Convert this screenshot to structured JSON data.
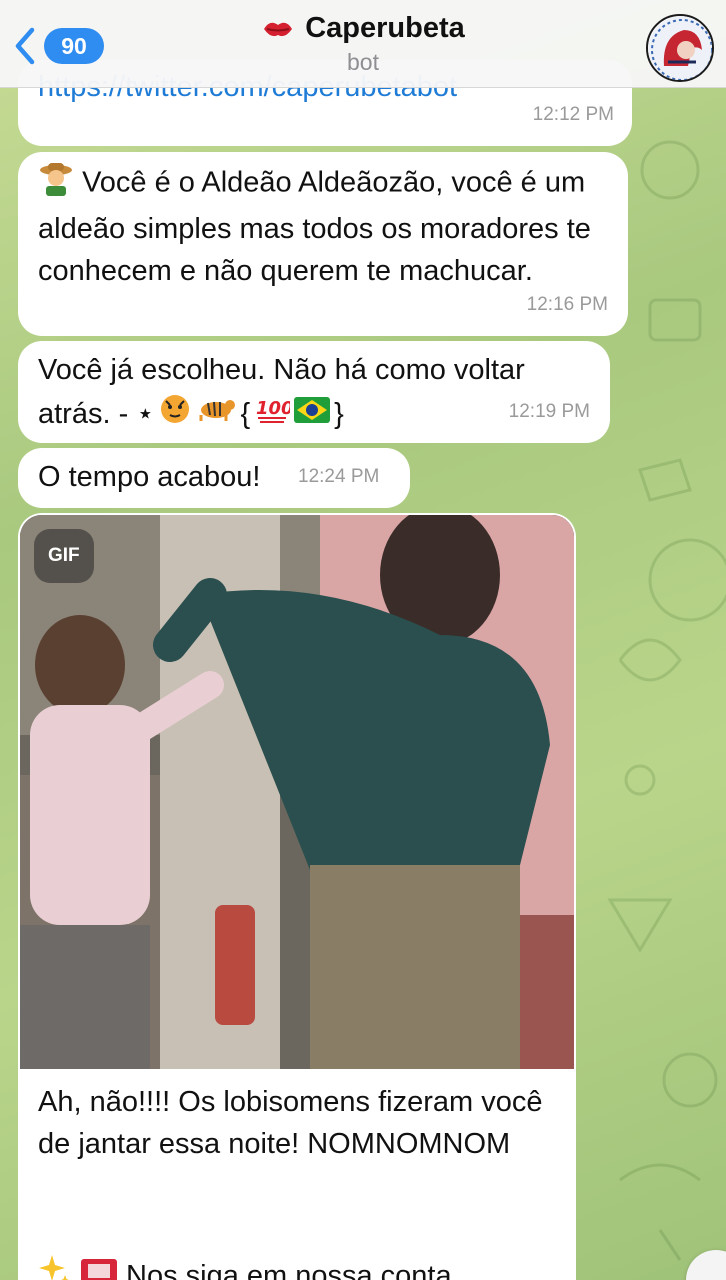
{
  "header": {
    "back_count": "90",
    "title": "Caperubeta",
    "subtitle": "bot"
  },
  "messages": {
    "m1": {
      "text": "https://twitter.com/caperubetabot",
      "time": "12:12 PM"
    },
    "m2": {
      "text": "Você é o Aldeão Aldeãozão, você é um aldeão simples mas todos os moradores te conhecem e não querem te machucar.",
      "time": "12:16 PM"
    },
    "m3": {
      "text_line1": "Você já escolheu. Não há como voltar",
      "text_line2": "atrás. - ⋆ ",
      "text_tail": "{",
      "text_end": "}",
      "time": "12:19 PM"
    },
    "m4": {
      "text": "O tempo acabou!",
      "time": "12:24 PM"
    },
    "m5": {
      "gif_label": "GIF",
      "caption": "Ah, não!!!! Os lobisomens fizeram você de jantar essa noite! NOMNOMNOM",
      "caption2": "Nos siga em nossa conta"
    }
  },
  "icons": {
    "back": "chevron-left-icon",
    "lips": "kiss-mark-icon",
    "farmer": "farmer-emoji",
    "tiger_face": "tiger-face-emoji",
    "tiger": "tiger-emoji",
    "hundred": "hundred-points-emoji",
    "flag": "brazil-flag-emoji",
    "sparkles": "sparkles-emoji",
    "ticket": "admission-ticket-emoji"
  },
  "colors": {
    "accent": "#2f8cf0",
    "link": "#1f7cd6",
    "bubble": "#ffffff"
  }
}
